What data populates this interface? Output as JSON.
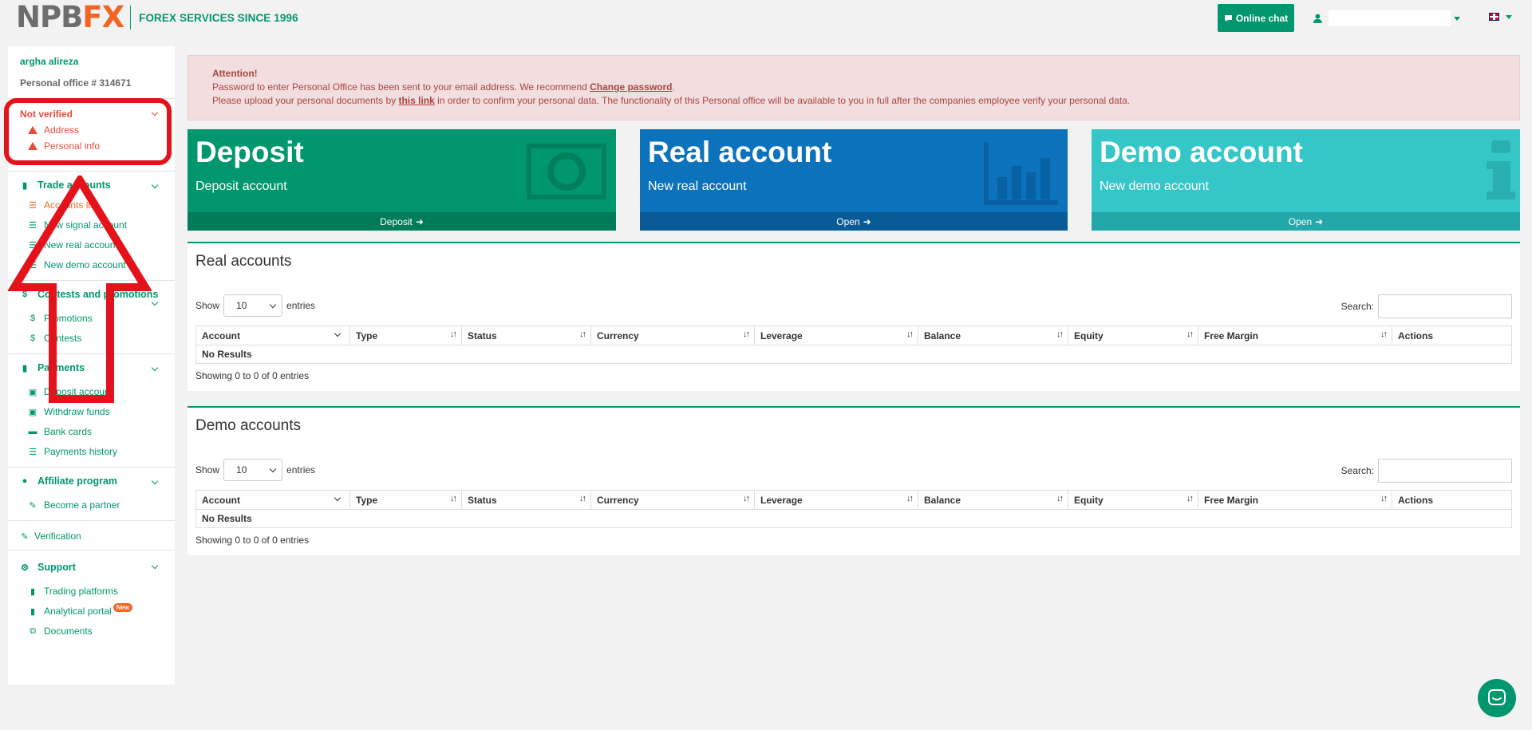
{
  "header": {
    "logo_main": "NPB",
    "logo_fx": "FX",
    "tagline": "FOREX SERVICES SINCE 1996",
    "online_chat": "Online chat",
    "brand_color": "#00966e",
    "accent_color": "#f26522"
  },
  "sidebar": {
    "user_name": "argha alireza",
    "office_label": "Personal office # 314671",
    "verification": {
      "status": "Not verified",
      "items": [
        "Address",
        "Personal info"
      ]
    },
    "trade_accounts": {
      "title": "Trade accounts",
      "items": [
        "Accounts list",
        "New signal account",
        "New real account",
        "New demo account"
      ]
    },
    "contests": {
      "title": "Contests and promotions",
      "items": [
        "Promotions",
        "Contests"
      ]
    },
    "payments": {
      "title": "Payments",
      "items": [
        "Deposit account",
        "Withdraw funds",
        "Bank cards",
        "Payments history"
      ]
    },
    "affiliate": {
      "title": "Affiliate program",
      "items": [
        "Become a partner"
      ]
    },
    "verification_link": "Verification",
    "support": {
      "title": "Support",
      "items": [
        "Trading platforms",
        "Analytical portal",
        "Documents"
      ],
      "new_badge": "New"
    }
  },
  "alert": {
    "title": "Attention!",
    "line1_a": "Password to enter Personal Office has been sent to your email address. We recommend ",
    "line1_link": "Change password",
    "line1_b": ".",
    "line2_a": "Please upload your personal documents by ",
    "line2_link": "this link",
    "line2_b": " in order to confirm your personal data. The functionality of this Personal office will be available to you in full after the companies employee verify your personal data."
  },
  "tiles": [
    {
      "title": "Deposit",
      "subtitle": "Deposit account",
      "action": "Deposit"
    },
    {
      "title": "Real account",
      "subtitle": "New real account",
      "action": "Open"
    },
    {
      "title": "Demo account",
      "subtitle": "New demo account",
      "action": "Open"
    }
  ],
  "table_common": {
    "show": "Show",
    "entries": "entries",
    "page_size": "10",
    "search": "Search:",
    "columns": [
      "Account",
      "Type",
      "Status",
      "Currency",
      "Leverage",
      "Balance",
      "Equity",
      "Free Margin",
      "Actions"
    ],
    "no_results": "No Results",
    "info": "Showing 0 to 0 of 0 entries"
  },
  "real_accounts": {
    "title": "Real accounts"
  },
  "demo_accounts": {
    "title": "Demo accounts"
  }
}
